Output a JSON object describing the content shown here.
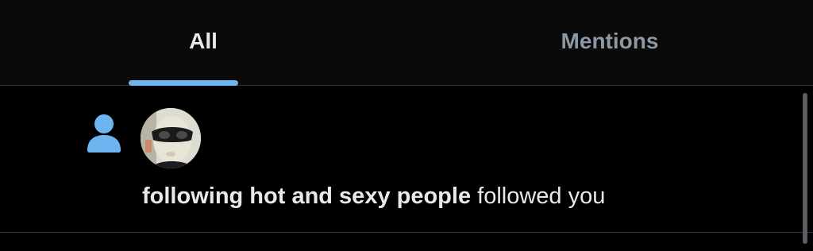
{
  "tabs": [
    {
      "label": "All",
      "active": true
    },
    {
      "label": "Mentions",
      "active": false
    }
  ],
  "notification": {
    "icon": "person-icon",
    "name": "following hot and sexy people",
    "action": "followed you"
  },
  "colors": {
    "background": "#000000",
    "accent": "#6cb5f0",
    "text_primary": "#e7e9ea",
    "text_secondary": "#8b98a5",
    "divider": "#2f3336"
  }
}
